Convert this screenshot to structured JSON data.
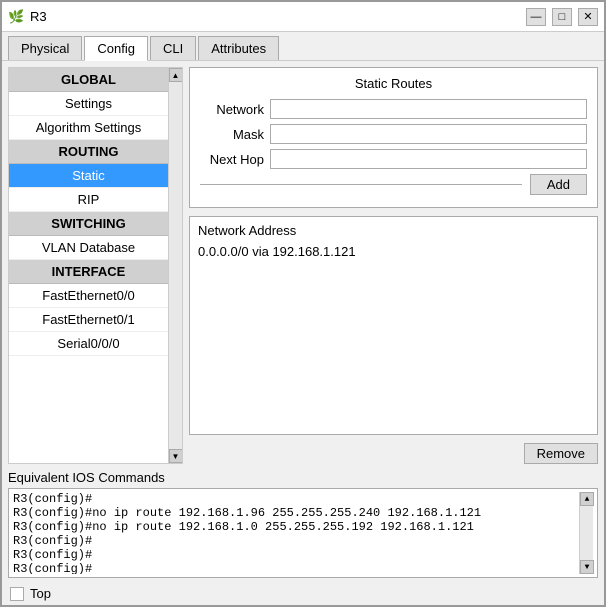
{
  "window": {
    "title": "R3",
    "icon": "🌿",
    "controls": {
      "minimize": "—",
      "maximize": "□",
      "close": "✕"
    }
  },
  "tabs": [
    {
      "label": "Physical",
      "active": false
    },
    {
      "label": "Config",
      "active": true
    },
    {
      "label": "CLI",
      "active": false
    },
    {
      "label": "Attributes",
      "active": false
    }
  ],
  "sidebar": {
    "sections": [
      {
        "type": "header",
        "label": "GLOBAL"
      },
      {
        "type": "item",
        "label": "Settings",
        "selected": false
      },
      {
        "type": "item",
        "label": "Algorithm Settings",
        "selected": false
      },
      {
        "type": "header",
        "label": "ROUTING"
      },
      {
        "type": "item",
        "label": "Static",
        "selected": true
      },
      {
        "type": "item",
        "label": "RIP",
        "selected": false
      },
      {
        "type": "header",
        "label": "SWITCHING"
      },
      {
        "type": "item",
        "label": "VLAN Database",
        "selected": false
      },
      {
        "type": "header",
        "label": "INTERFACE"
      },
      {
        "type": "item",
        "label": "FastEthernet0/0",
        "selected": false
      },
      {
        "type": "item",
        "label": "FastEthernet0/1",
        "selected": false
      },
      {
        "type": "item",
        "label": "Serial0/0/0",
        "selected": false
      }
    ]
  },
  "main": {
    "static_routes_title": "Static Routes",
    "network_label": "Network",
    "mask_label": "Mask",
    "next_hop_label": "Next Hop",
    "add_button": "Add",
    "network_address_title": "Network Address",
    "network_entries": [
      "0.0.0.0/0 via 192.168.1.121"
    ],
    "remove_button": "Remove"
  },
  "ios": {
    "label": "Equivalent IOS Commands",
    "lines": [
      "R3(config)#",
      "R3(config)#no ip route 192.168.1.96 255.255.255.240 192.168.1.121",
      "R3(config)#no ip route 192.168.1.0 255.255.255.192 192.168.1.121",
      "R3(config)#",
      "R3(config)#",
      "R3(config)#"
    ]
  },
  "footer": {
    "top_checkbox": false,
    "top_label": "Top"
  }
}
